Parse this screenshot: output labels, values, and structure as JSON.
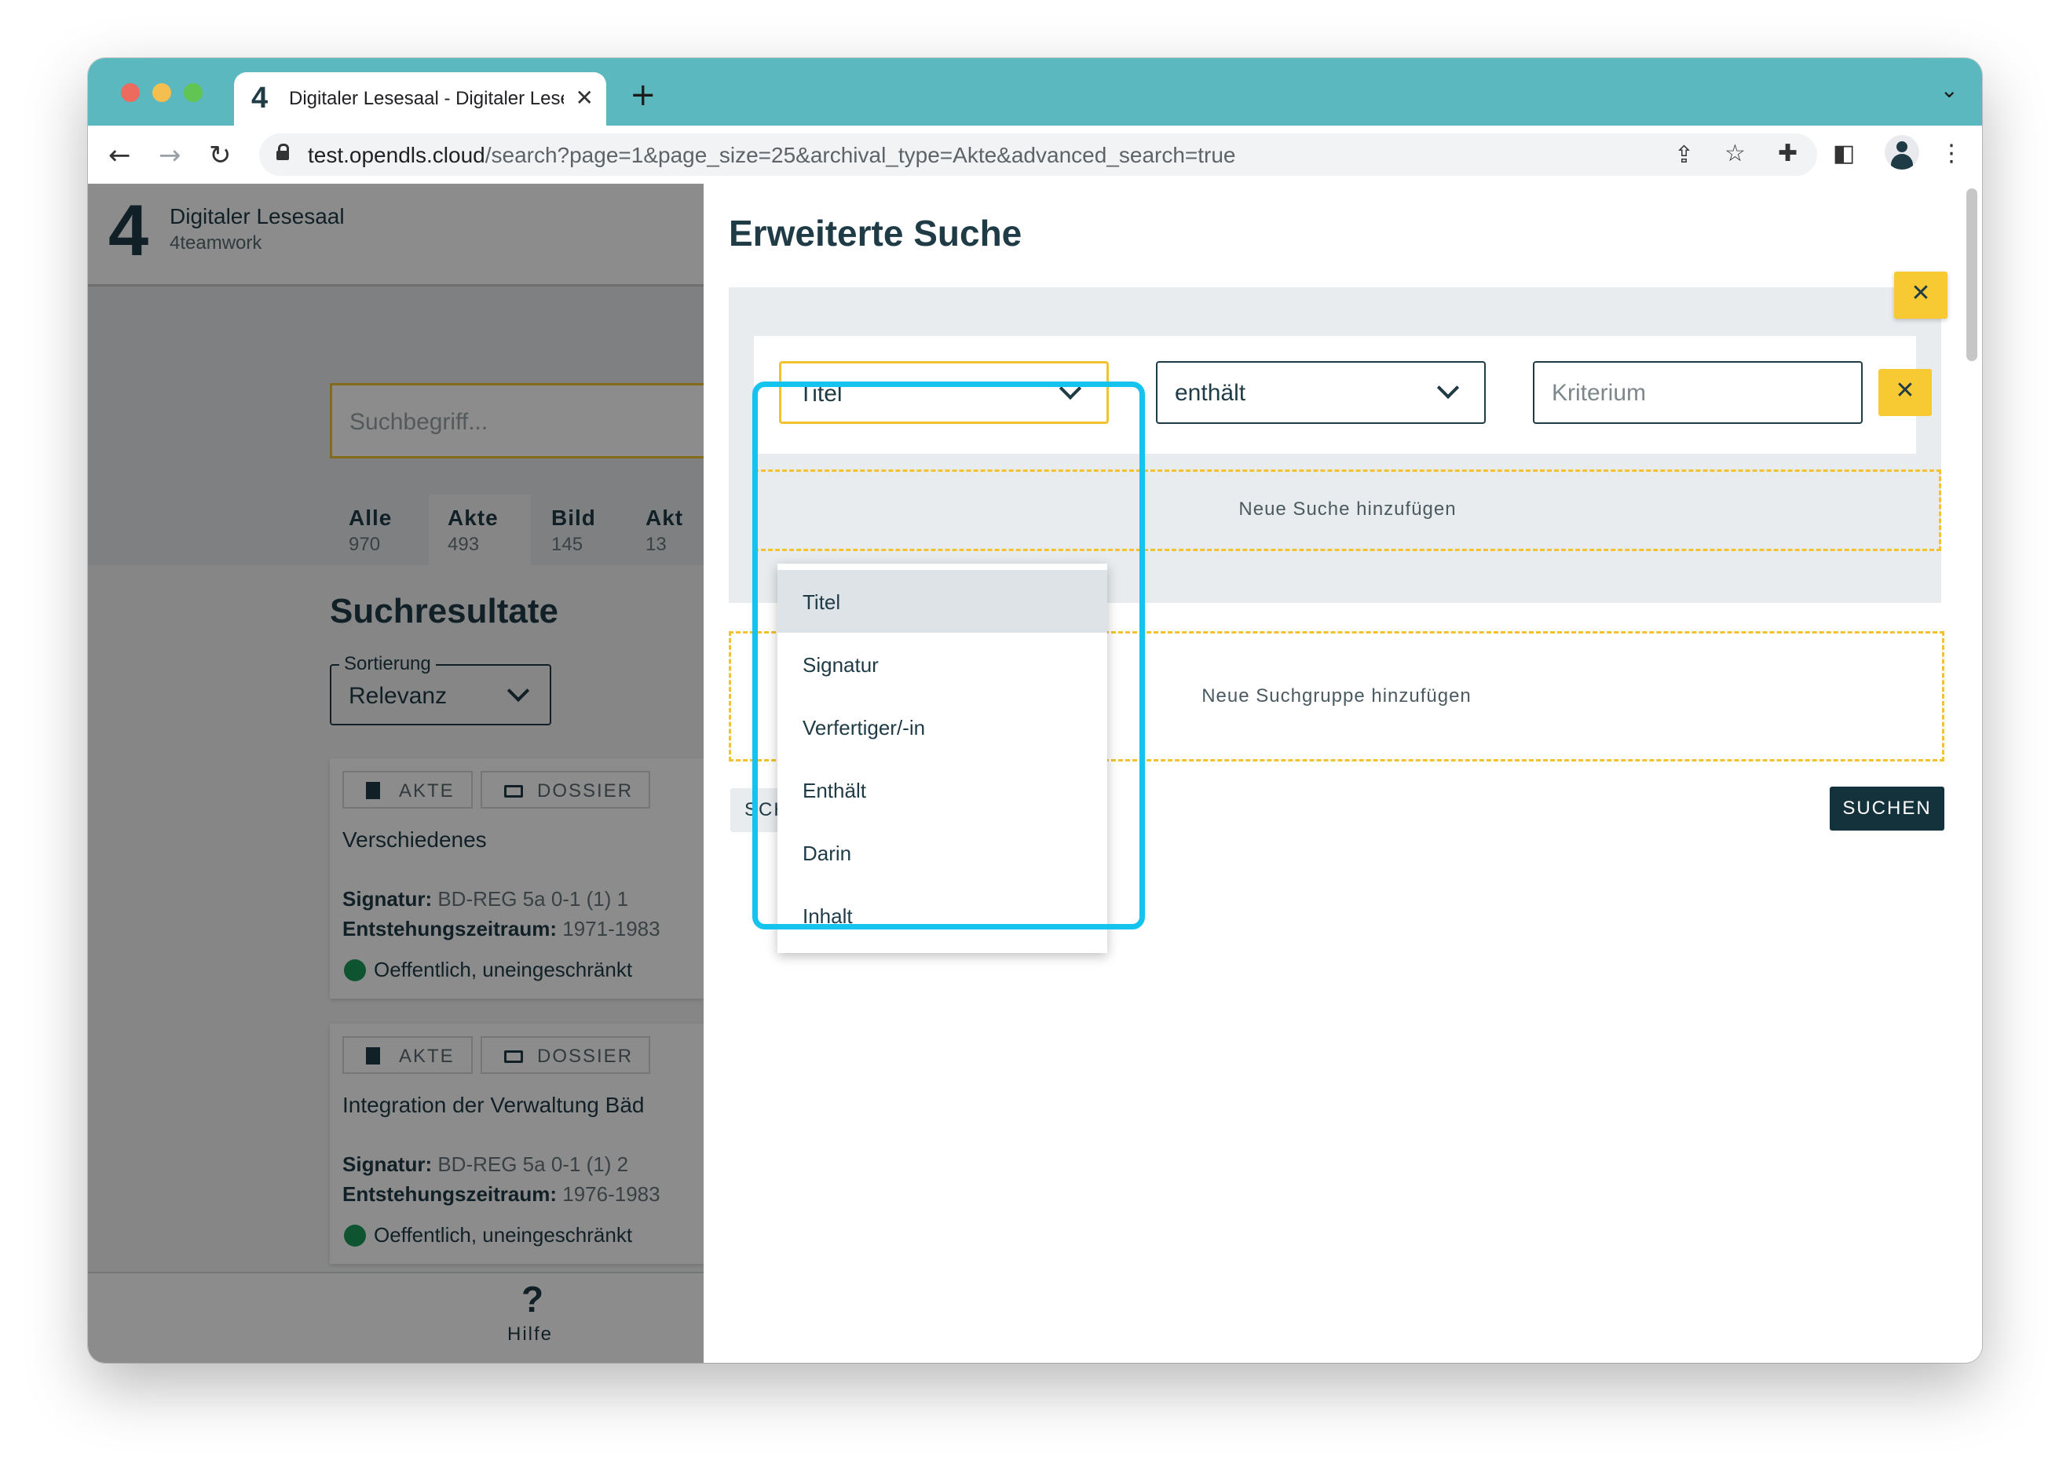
{
  "browser": {
    "tab_title": "Digitaler Lesesaal - Digitaler Lesesaal",
    "tab_close": "✕",
    "new_tab": "+",
    "url_host": "test.opendls.cloud",
    "url_path": "/search?page=1&page_size=25&archival_type=Akte&advanced_search=true"
  },
  "sidebar": {
    "logo": "4",
    "title": "Digitaler Lesesaal",
    "subtitle": "4teamwork",
    "search_placeholder": "Suchbegriff...",
    "categories": [
      {
        "label": "Alle",
        "count": "970"
      },
      {
        "label": "Akte",
        "count": "493"
      },
      {
        "label": "Bild",
        "count": "145"
      },
      {
        "label": "Akt",
        "count": "13"
      }
    ],
    "results_title": "Suchresultate",
    "sort_label": "Sortierung",
    "sort_value": "Relevanz",
    "cards": [
      {
        "chip1": "AKTE",
        "chip2": "DOSSIER",
        "title": "Verschiedenes",
        "signatur_label": "Signatur:",
        "signatur": "BD-REG 5a 0-1 (1) 1",
        "zeitraum_label": "Entstehungszeitraum:",
        "zeitraum": "1971-1983",
        "status": "Oeffentlich, uneingeschränkt"
      },
      {
        "chip1": "AKTE",
        "chip2": "DOSSIER",
        "title": "Integration der Verwaltung Bäd",
        "signatur_label": "Signatur:",
        "signatur": "BD-REG 5a 0-1 (1) 2",
        "zeitraum_label": "Entstehungszeitraum:",
        "zeitraum": "1976-1983",
        "status": "Oeffentlich, uneingeschränkt"
      }
    ],
    "help_icon": "?",
    "help_label": "Hilfe"
  },
  "panel": {
    "title": "Erweiterte Suche",
    "group_close": "✕",
    "field_value": "Titel",
    "operator_value": "enthält",
    "criterion_placeholder": "Kriterium",
    "row_remove": "✕",
    "add_search": "Neue Suche hinzufügen",
    "add_group": "Neue Suchgruppe hinzufügen",
    "secondary_button": "SCH",
    "search_button": "SUCHEN"
  },
  "dropdown": {
    "options": [
      "Titel",
      "Signatur",
      "Verfertiger/-in",
      "Enthält",
      "Darin",
      "Inhalt"
    ],
    "selected": "Titel"
  },
  "colors": {
    "teal_titlebar": "#5cb8bf",
    "accent_yellow": "#f7c932",
    "dark_navy": "#13323c",
    "highlight_cyan": "#14c4ef",
    "status_green": "#1b9a59"
  }
}
